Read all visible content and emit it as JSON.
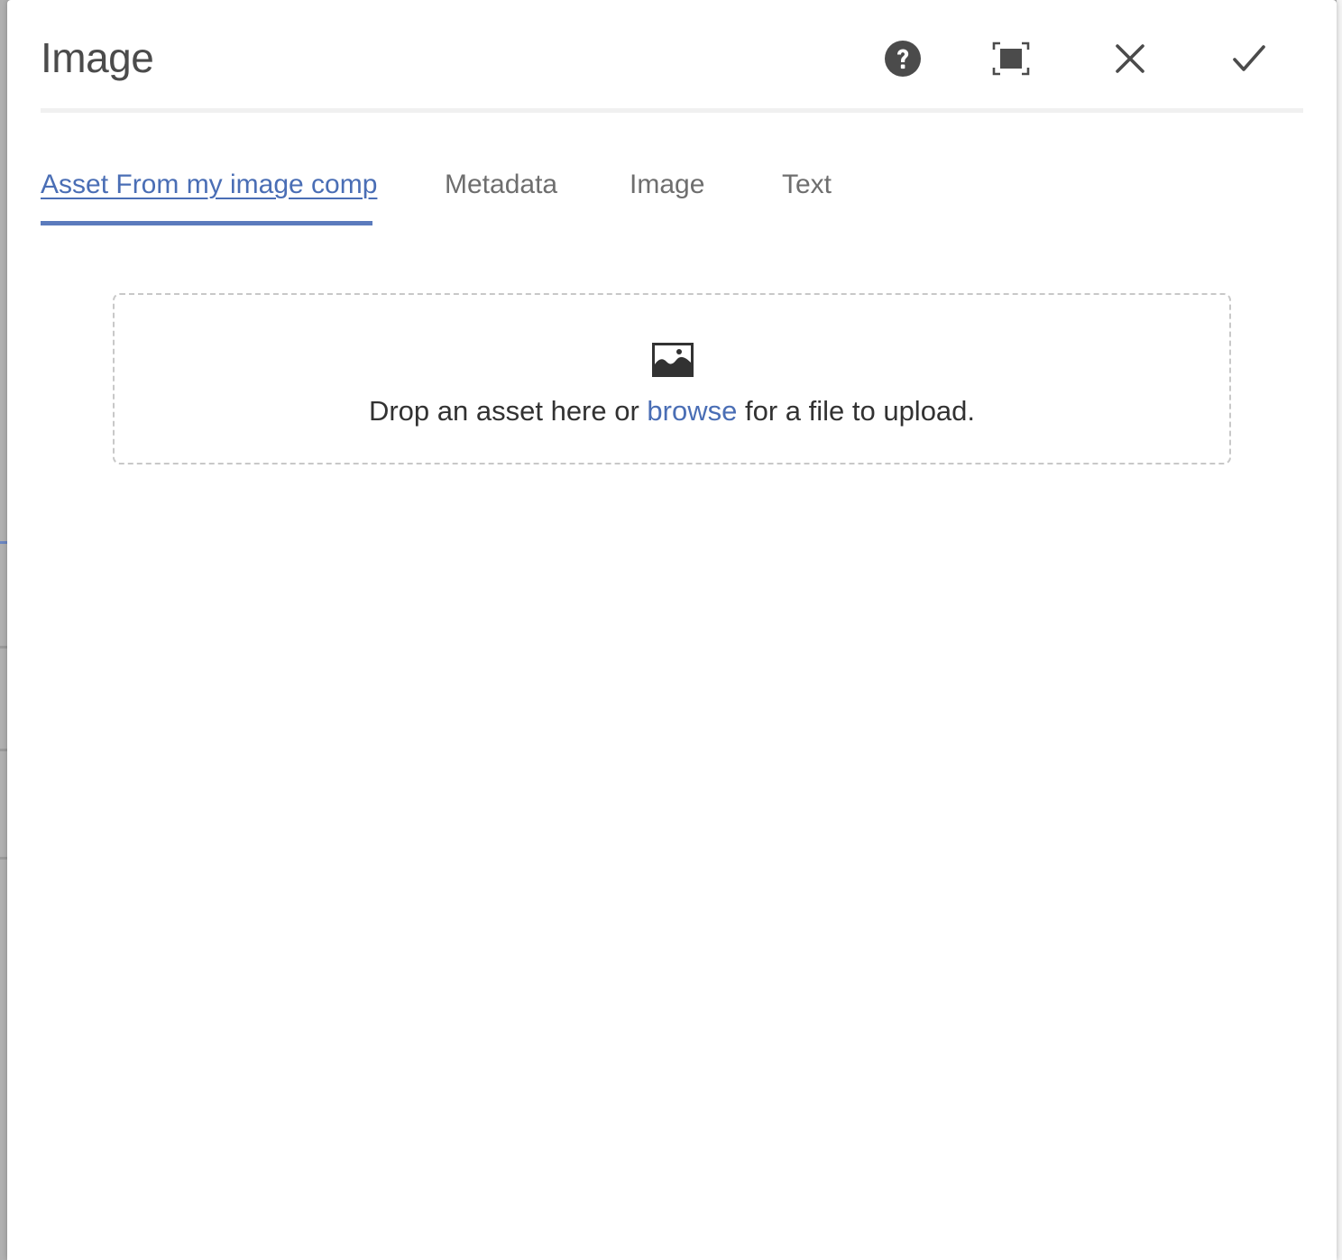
{
  "dialog": {
    "title": "Image",
    "header_buttons": [
      {
        "name": "help",
        "icon": "help-icon"
      },
      {
        "name": "fullscreen",
        "icon": "fullscreen-icon"
      },
      {
        "name": "cancel",
        "icon": "close-icon"
      },
      {
        "name": "done",
        "icon": "checkmark-icon"
      }
    ]
  },
  "tabs": [
    {
      "label": "Asset From my image comp",
      "active": true
    },
    {
      "label": "Metadata",
      "active": false
    },
    {
      "label": "Image",
      "active": false
    },
    {
      "label": "Text",
      "active": false
    }
  ],
  "dropzone": {
    "icon": "image-icon",
    "text_before": "Drop an asset here or ",
    "link_text": "browse",
    "text_after": " for a file to upload."
  },
  "colors": {
    "accent": "#4a6eb5",
    "icon_gray": "#4b4b4b",
    "text": "#323232"
  }
}
